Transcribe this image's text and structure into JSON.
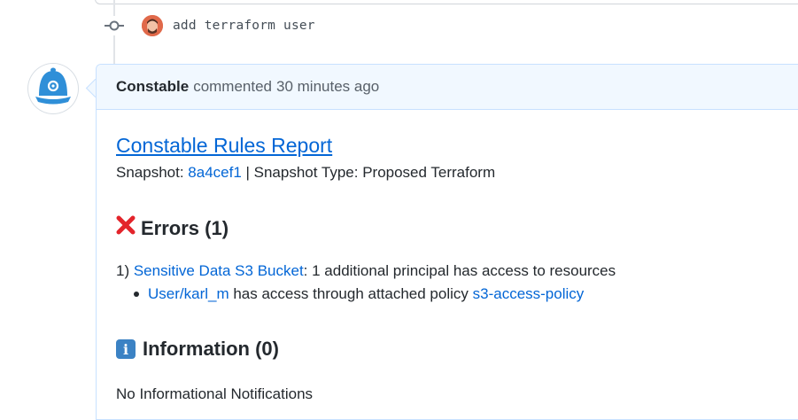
{
  "commit": {
    "message": "add terraform user"
  },
  "comment": {
    "author": "Constable",
    "action": "commented",
    "time": "30 minutes ago"
  },
  "report": {
    "title": "Constable Rules Report",
    "snapshot_label": "Snapshot: ",
    "snapshot_id": "8a4cef1",
    "snapshot_sep": " | Snapshot Type: Proposed Terraform",
    "errors_heading": "Errors (1)",
    "error_prefix": "1) ",
    "error_rule": "Sensitive Data S3 Bucket",
    "error_text": ": 1 additional principal has access to resources",
    "sub_principal": "User/karl_m",
    "sub_text": " has access through attached policy ",
    "sub_policy": "s3-access-policy",
    "info_heading": "Information (0)",
    "info_icon_char": "i",
    "no_info": "No Informational Notifications"
  },
  "colors": {
    "link": "#0366d6",
    "header_bg": "#f1f8ff",
    "header_border": "#c8e1ff",
    "error_red": "#e3242b",
    "info_blue": "#3b82c4",
    "bot_blue": "#2f8fd8"
  },
  "icons": {
    "commit": "git-commit-icon",
    "bot": "constable-helmet-icon",
    "error": "cross-mark-icon",
    "info": "information-icon"
  }
}
